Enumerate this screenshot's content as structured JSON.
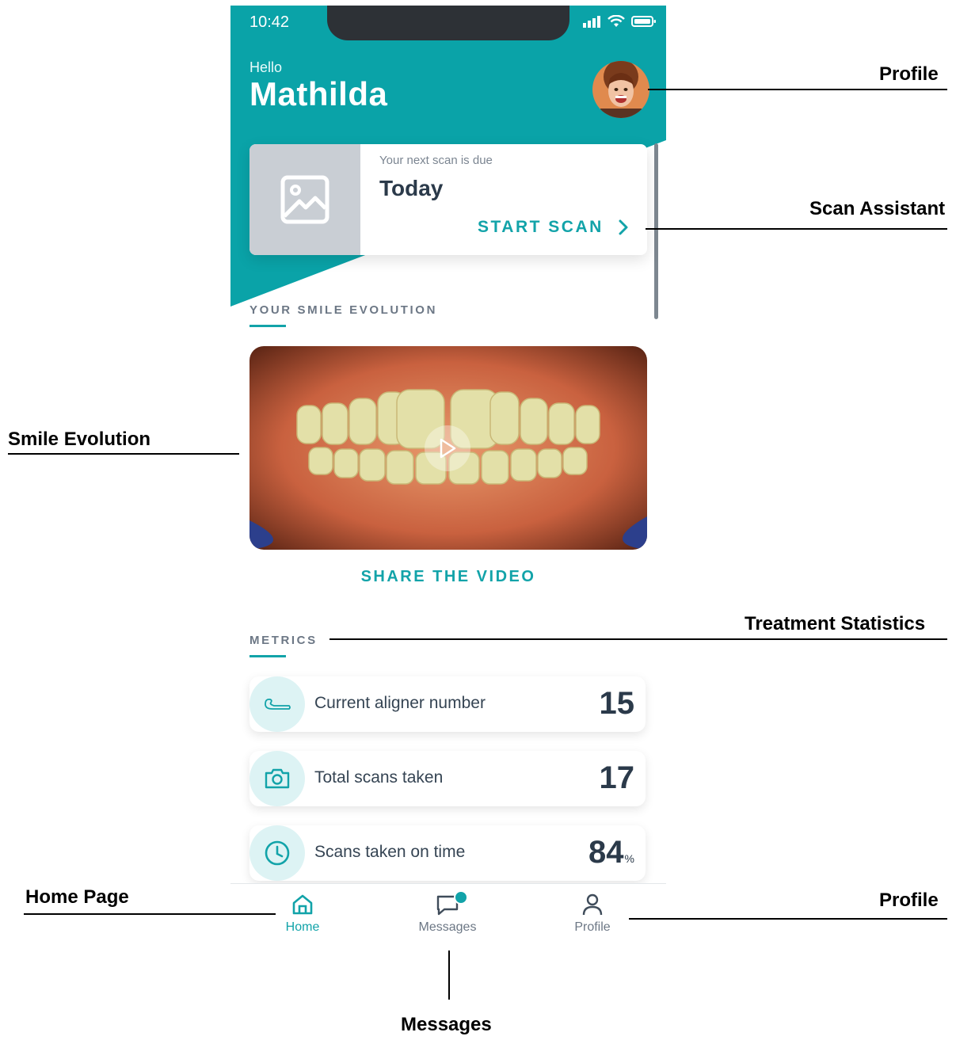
{
  "status_bar": {
    "time": "10:42"
  },
  "header": {
    "greeting": "Hello",
    "username": "Mathilda"
  },
  "scan_card": {
    "due_label": "Your next scan is due",
    "due_date": "Today",
    "action_label": "START SCAN"
  },
  "smile_evolution": {
    "section_title": "YOUR SMILE EVOLUTION",
    "share_label": "SHARE THE VIDEO"
  },
  "metrics": {
    "section_title": "METRICS",
    "items": [
      {
        "label": "Current aligner number",
        "value": "15",
        "unit": "",
        "icon": "aligner-icon"
      },
      {
        "label": "Total scans taken",
        "value": "17",
        "unit": "",
        "icon": "camera-icon"
      },
      {
        "label": "Scans taken on time",
        "value": "84",
        "unit": "%",
        "icon": "clock-icon"
      }
    ]
  },
  "bottom_nav": {
    "items": [
      {
        "label": "Home",
        "icon": "home-icon",
        "active": true
      },
      {
        "label": "Messages",
        "icon": "message-icon",
        "active": false,
        "badge": true
      },
      {
        "label": "Profile",
        "icon": "user-icon",
        "active": false
      }
    ]
  },
  "annotations": {
    "profile_top": "Profile",
    "scan_assistant": "Scan Assistant",
    "smile_evolution": "Smile Evolution",
    "treatment_statistics": "Treatment Statistics",
    "home_page": "Home Page",
    "profile_bottom": "Profile",
    "messages": "Messages"
  },
  "colors": {
    "accent": "#12a3a9",
    "header": "#0aa3a8",
    "text": "#2b3a4a"
  }
}
